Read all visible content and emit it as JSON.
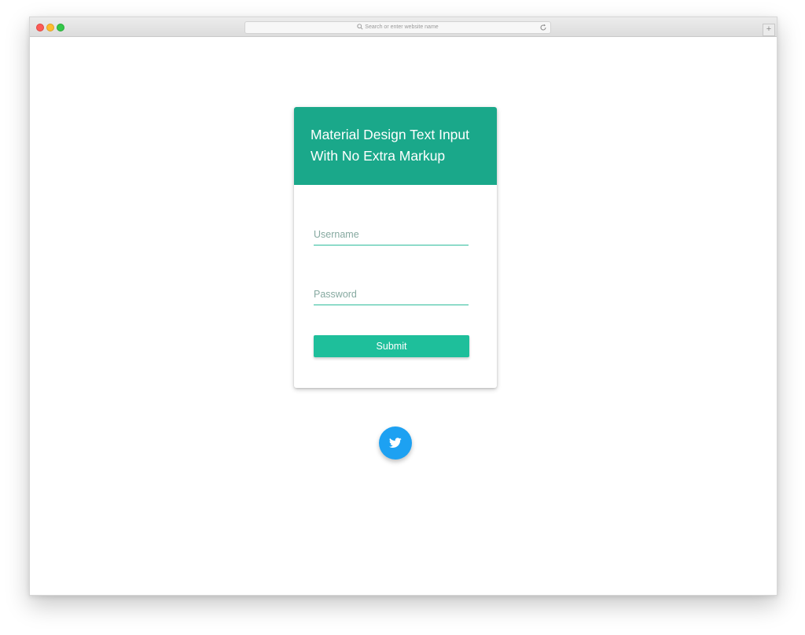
{
  "browser": {
    "address_placeholder": "Search or enter website name",
    "newtab_label": "+",
    "icons": {
      "search": "search-icon",
      "reload": "reload-icon",
      "new_tab": "plus-icon"
    }
  },
  "card": {
    "title": "Material Design Text Input With No Extra Markup",
    "header_color": "#1aa88a",
    "accent_color": "#1ebf9b",
    "username": {
      "placeholder": "Username",
      "value": ""
    },
    "password": {
      "placeholder": "Password",
      "value": ""
    },
    "submit_label": "Submit"
  },
  "social": {
    "twitter_icon": "twitter-icon",
    "twitter_color": "#1da1f2"
  }
}
